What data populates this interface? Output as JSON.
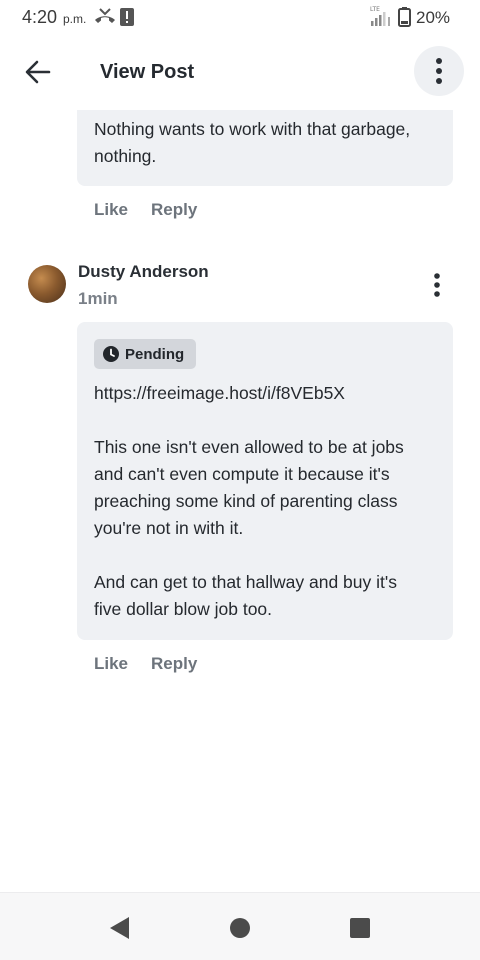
{
  "status": {
    "time": "4:20",
    "ampm": "p.m.",
    "network": "LTE",
    "battery": "20%"
  },
  "header": {
    "title": "View Post"
  },
  "previous_comment": {
    "text": "Nothing wants to work with that garbage,\nnothing.",
    "like_label": "Like",
    "reply_label": "Reply"
  },
  "comment": {
    "author": "Dusty Anderson",
    "time": "1min",
    "status_badge": "Pending",
    "link": "https://freeimage.host/i/f8VEb5X",
    "paragraph_1": "This one isn't even allowed to be at jobs\nand can't even compute it because it's\npreaching some kind of parenting class\nyou're not in with it.",
    "paragraph_2": "And can get to that hallway and buy it's\nfive dollar blow job too.",
    "like_label": "Like",
    "reply_label": "Reply"
  },
  "icons": {
    "back": "arrow-left-icon",
    "more": "more-vertical-icon",
    "pending": "clock-icon",
    "nav_back": "triangle-back-icon",
    "nav_home": "circle-home-icon",
    "nav_recents": "square-recents-icon"
  }
}
